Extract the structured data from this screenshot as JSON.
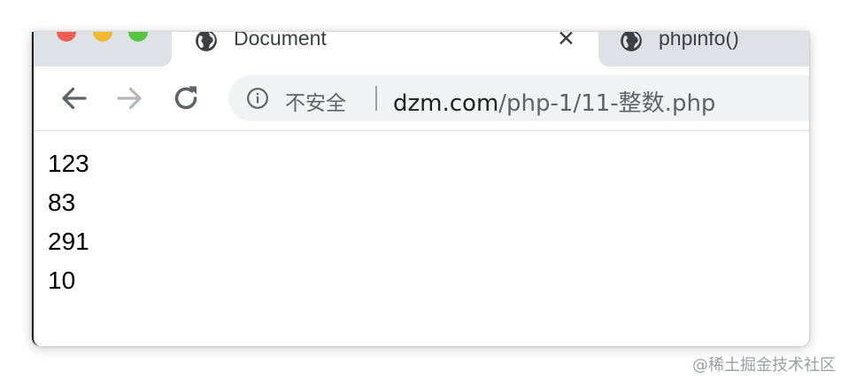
{
  "browser": {
    "tabs": [
      {
        "title": "Document",
        "active": true,
        "icon": "globe-icon"
      },
      {
        "title": "phpinfo()",
        "active": false,
        "icon": "globe-icon"
      }
    ],
    "tab_close_glyph": "✕",
    "address_bar": {
      "security_label": "不安全",
      "url_host": "dzm.com",
      "url_path": "/php-1/11-整数.php"
    }
  },
  "page": {
    "output_lines": [
      "123",
      "83",
      "291",
      "10"
    ]
  },
  "watermark": "@稀土掘金技术社区",
  "colors": {
    "close_red": "#ee5e57",
    "minimize_yellow": "#f3b82f",
    "zoom_green": "#56c440",
    "tabstrip_bg": "#dee1e6",
    "omnibox_bg": "#f1f3f4"
  }
}
